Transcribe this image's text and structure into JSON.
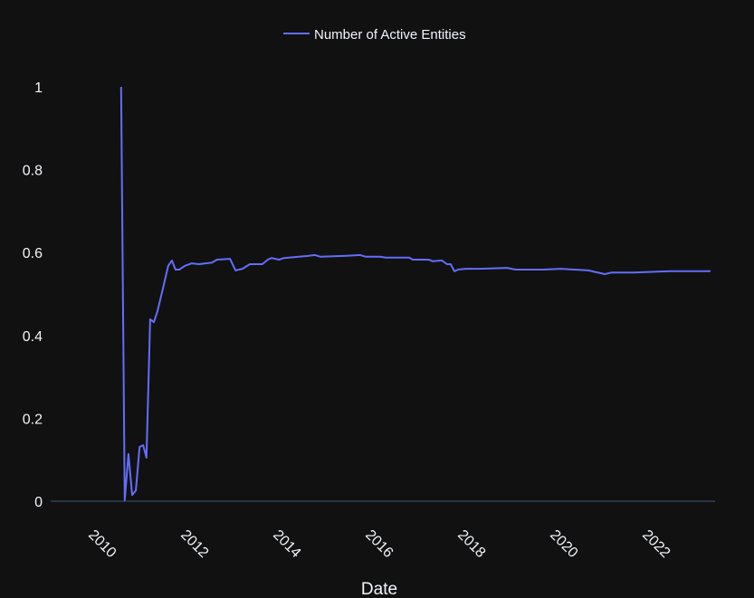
{
  "chart_data": {
    "type": "line",
    "title": "",
    "xlabel": "Date",
    "ylabel": "",
    "xlim": [
      2009.7,
      2023.9
    ],
    "ylim": [
      0,
      1.05
    ],
    "x_ticks": [
      2010,
      2012,
      2014,
      2016,
      2018,
      2020,
      2022
    ],
    "x_tick_labels": [
      "2010",
      "2012",
      "2014",
      "2016",
      "2018",
      "2020",
      "2022"
    ],
    "y_ticks": [
      0,
      0.2,
      0.4,
      0.6,
      0.8,
      1
    ],
    "y_tick_labels": [
      "0",
      "0.2",
      "0.4",
      "0.6",
      "0.8",
      "1"
    ],
    "grid": false,
    "legend": {
      "position": "top-center",
      "entries": [
        "Number of Active Entities"
      ]
    },
    "series": [
      {
        "name": "Number of Active Entities",
        "color": "#636efa",
        "x": [
          2010.76,
          2010.84,
          2010.92,
          2011.0,
          2011.08,
          2011.16,
          2011.24,
          2011.31,
          2011.39,
          2011.47,
          2011.55,
          2011.67,
          2011.78,
          2011.86,
          2011.94,
          2012.02,
          2012.14,
          2012.29,
          2012.45,
          2012.73,
          2012.84,
          2013.12,
          2013.24,
          2013.39,
          2013.55,
          2013.82,
          2013.94,
          2014.02,
          2014.18,
          2014.29,
          2014.8,
          2014.96,
          2015.08,
          2015.59,
          2015.94,
          2016.06,
          2016.37,
          2016.49,
          2017.0,
          2017.08,
          2017.43,
          2017.51,
          2017.71,
          2017.82,
          2017.9,
          2017.98,
          2018.06,
          2018.22,
          2018.53,
          2019.12,
          2019.31,
          2019.9,
          2020.29,
          2020.88,
          2021.24,
          2021.39,
          2021.86,
          2022.65,
          2023.53
        ],
        "y": [
          1.0,
          0.002,
          0.114,
          0.015,
          0.026,
          0.131,
          0.135,
          0.105,
          0.439,
          0.432,
          0.459,
          0.515,
          0.568,
          0.581,
          0.559,
          0.559,
          0.568,
          0.574,
          0.572,
          0.576,
          0.583,
          0.585,
          0.557,
          0.561,
          0.572,
          0.572,
          0.583,
          0.587,
          0.583,
          0.587,
          0.592,
          0.594,
          0.59,
          0.592,
          0.594,
          0.59,
          0.59,
          0.588,
          0.588,
          0.583,
          0.583,
          0.579,
          0.581,
          0.572,
          0.572,
          0.555,
          0.559,
          0.561,
          0.561,
          0.563,
          0.559,
          0.559,
          0.561,
          0.557,
          0.548,
          0.552,
          0.552,
          0.555,
          0.555
        ]
      }
    ]
  }
}
